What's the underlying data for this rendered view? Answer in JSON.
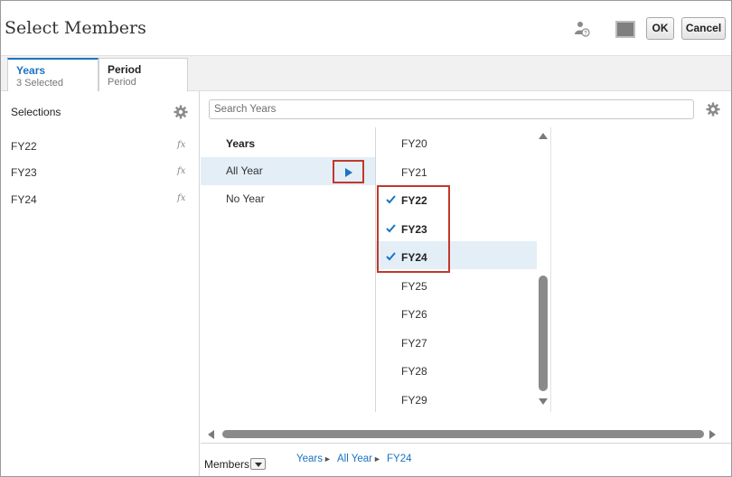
{
  "dialog": {
    "title": "Select Members"
  },
  "header": {
    "ok_label": "OK",
    "cancel_label": "Cancel",
    "icons": [
      "user-help-icon",
      "color-square-icon"
    ]
  },
  "tabs": [
    {
      "title": "Years",
      "subtitle": "3 Selected",
      "active": true
    },
    {
      "title": "Period",
      "subtitle": "Period",
      "active": false
    }
  ],
  "selections": {
    "title": "Selections",
    "items": [
      {
        "label": "FY22",
        "fx": "fx"
      },
      {
        "label": "FY23",
        "fx": "fx"
      },
      {
        "label": "FY24",
        "fx": "fx"
      }
    ]
  },
  "search": {
    "placeholder": "Search Years",
    "value": ""
  },
  "hierarchy": {
    "header": "Years",
    "items": [
      {
        "label": "All Year",
        "selected": true
      },
      {
        "label": "No Year",
        "selected": false
      }
    ]
  },
  "members": {
    "items": [
      {
        "label": "FY20",
        "checked": false
      },
      {
        "label": "FY21",
        "checked": false
      },
      {
        "label": "FY22",
        "checked": true
      },
      {
        "label": "FY23",
        "checked": true
      },
      {
        "label": "FY24",
        "checked": true
      },
      {
        "label": "FY25",
        "checked": false
      },
      {
        "label": "FY26",
        "checked": false
      },
      {
        "label": "FY27",
        "checked": false
      },
      {
        "label": "FY28",
        "checked": false
      },
      {
        "label": "FY29",
        "checked": false
      }
    ]
  },
  "footer": {
    "label": "Members",
    "breadcrumb": [
      "Years",
      "All Year",
      "FY24"
    ]
  },
  "colors": {
    "accent": "#1a73c2",
    "highlight": "#c0392b",
    "selected_row": "#e4eef7"
  }
}
